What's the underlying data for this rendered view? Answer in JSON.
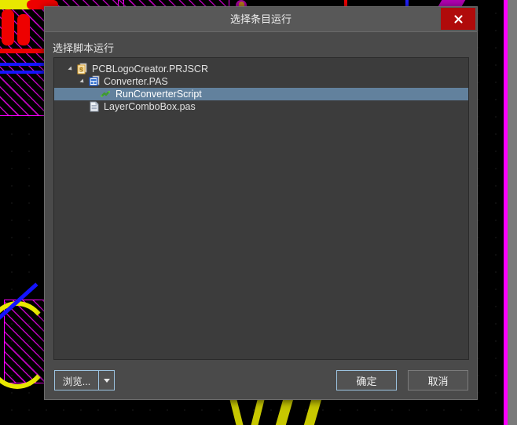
{
  "dialog": {
    "title": "选择条目运行",
    "close_icon": "close-icon",
    "prompt": "选择脚本运行",
    "tree": [
      {
        "label": "PCBLogoCreator.PRJSCR",
        "depth": 0,
        "expander": "chevron-expanded-icon",
        "icon": "project-script-file-icon",
        "selected": false
      },
      {
        "label": "Converter.PAS",
        "depth": 1,
        "expander": "chevron-expanded-icon",
        "icon": "pascal-script-file-icon",
        "selected": false
      },
      {
        "label": "RunConverterScript",
        "depth": 2,
        "expander": "",
        "icon": "procedure-icon",
        "selected": true
      },
      {
        "label": "LayerComboBox.pas",
        "depth": 1,
        "expander": "",
        "icon": "pascal-file-icon",
        "selected": false
      }
    ],
    "footer": {
      "browse_label": "浏览...",
      "browse_dropdown_icon": "chevron-down-icon",
      "ok_label": "确定",
      "cancel_label": "取消"
    }
  },
  "colors": {
    "dialog_bg": "#4a4a4a",
    "titlebar_bg": "#585858",
    "close_red": "#b00b0b",
    "tree_bg": "#3c3c3c",
    "selection_blue": "#62819d",
    "focus_border": "#9cc3e0"
  }
}
